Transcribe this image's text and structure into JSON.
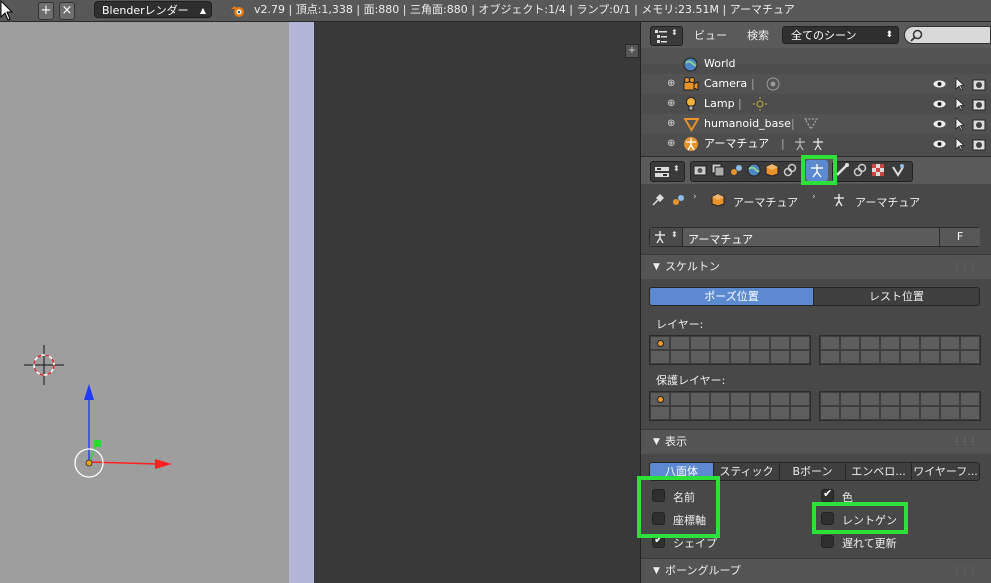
{
  "topbar": {
    "engine": "Blenderレンダー",
    "stats": "v2.79 | 頂点:1,338 | 面:880 | 三角面:880 | オブジェクト:1/4 | ランプ:0/1 | メモリ:23.51M | アーマチュア",
    "add_label": "+",
    "close_label": "×",
    "cursor_icon": "mouse-pointer-icon"
  },
  "outliner": {
    "menu_view": "ビュー",
    "menu_search": "検索",
    "scene_filter": "全てのシーン",
    "items": [
      {
        "label": "World",
        "icon": "world-icon"
      },
      {
        "label": "Camera",
        "icon": "camera-icon"
      },
      {
        "label": "Lamp",
        "icon": "lamp-icon"
      },
      {
        "label": "humanoid_base",
        "icon": "mesh-icon"
      },
      {
        "label": "アーマチュア",
        "icon": "armature-icon"
      }
    ]
  },
  "properties": {
    "breadcrumb_1": "アーマチュア",
    "breadcrumb_2": "アーマチュア",
    "datablock_name": "アーマチュア",
    "fake_user": "F",
    "skeleton": {
      "title": "スケルトン",
      "pose_position": "ポーズ位置",
      "rest_position": "レスト位置",
      "layers_label": "レイヤー:",
      "protected_layers_label": "保護レイヤー:"
    },
    "display": {
      "title": "表示",
      "tabs": [
        "八面体",
        "スティック",
        "Bボーン",
        "エンベロ...",
        "ワイヤーフ..."
      ],
      "names": "名前",
      "axes": "座標軸",
      "shapes": "シェイプ",
      "colors": "色",
      "xray": "レントゲン",
      "delay_refresh": "遅れて更新"
    },
    "bone_groups": {
      "title": "ボーングループ"
    }
  },
  "colors": {
    "highlight": "#2ee03a",
    "active_button": "#5b8ad0"
  }
}
